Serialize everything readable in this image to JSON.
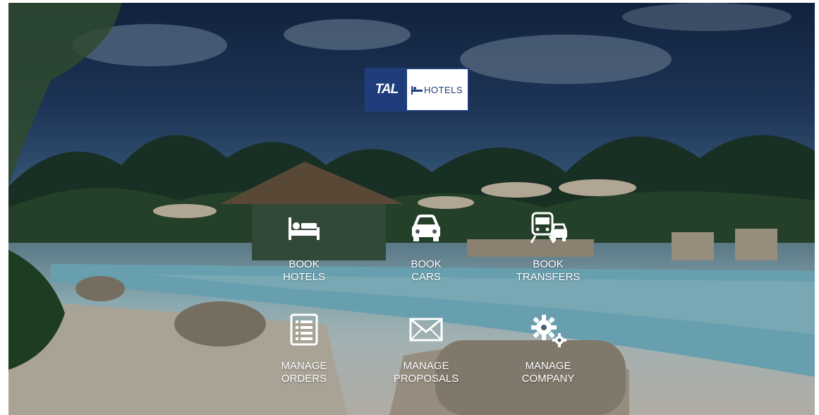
{
  "logo": {
    "left": "TAL",
    "right": "HOTELS"
  },
  "tiles": [
    {
      "line1": "BOOK",
      "line2": "HOTELS",
      "icon": "bed-icon"
    },
    {
      "line1": "BOOK",
      "line2": "CARS",
      "icon": "car-icon"
    },
    {
      "line1": "BOOK",
      "line2": "TRANSFERS",
      "icon": "train-car-icon"
    },
    {
      "line1": "MANAGE",
      "line2": "ORDERS",
      "icon": "list-icon"
    },
    {
      "line1": "MANAGE",
      "line2": "PROPOSALS",
      "icon": "envelope-icon"
    },
    {
      "line1": "MANAGE",
      "line2": "COMPANY",
      "icon": "gears-icon"
    }
  ],
  "colors": {
    "brand": "#1f3d7a",
    "text": "#ffffff"
  }
}
